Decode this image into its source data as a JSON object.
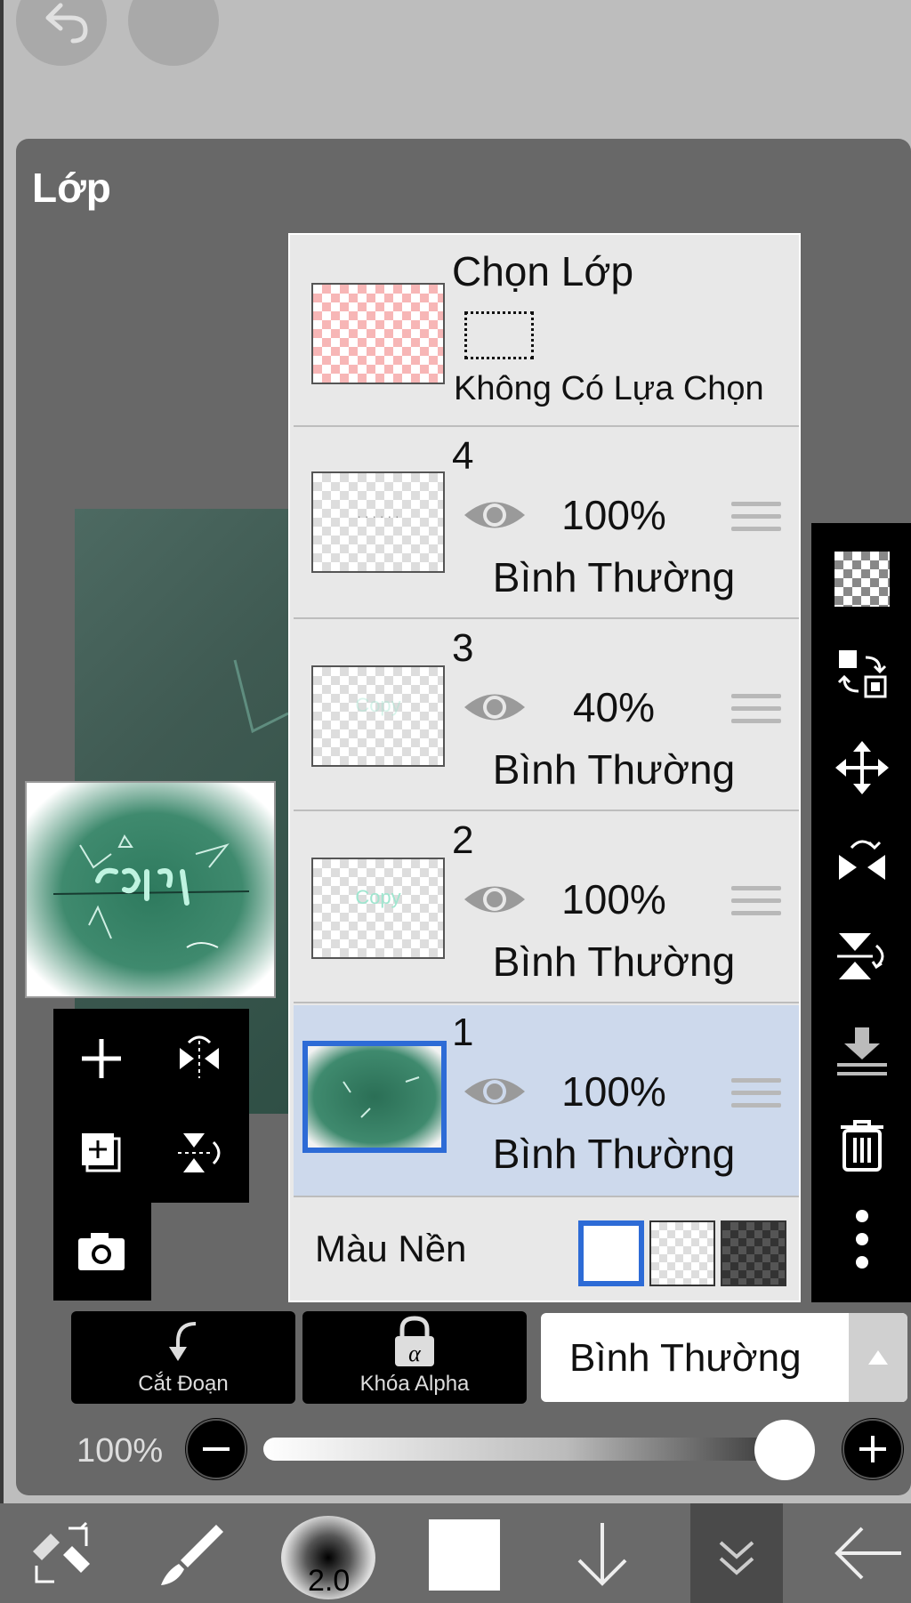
{
  "panel": {
    "title": "Lớp"
  },
  "selection_layer": {
    "title": "Chọn Lớp",
    "status": "Không Có Lựa Chọn"
  },
  "layers": [
    {
      "number": "4",
      "opacity": "100%",
      "mode": "Bình Thường",
      "selected": false
    },
    {
      "number": "3",
      "opacity": "40%",
      "mode": "Bình Thường",
      "selected": false
    },
    {
      "number": "2",
      "opacity": "100%",
      "mode": "Bình Thường",
      "selected": false
    },
    {
      "number": "1",
      "opacity": "100%",
      "mode": "Bình Thường",
      "selected": true
    }
  ],
  "background": {
    "label": "Màu Nền",
    "selected": "white"
  },
  "actions": {
    "clip_label": "Cắt Đoạn",
    "alpha_lock_label": "Khóa Alpha",
    "blend_mode": "Bình Thường"
  },
  "opacity_slider": {
    "label": "100%",
    "value": 1.0
  },
  "brush": {
    "size": "2.0"
  },
  "colors": {
    "selection_blue": "#2d6bd6",
    "selected_row": "#cdd9ec"
  }
}
